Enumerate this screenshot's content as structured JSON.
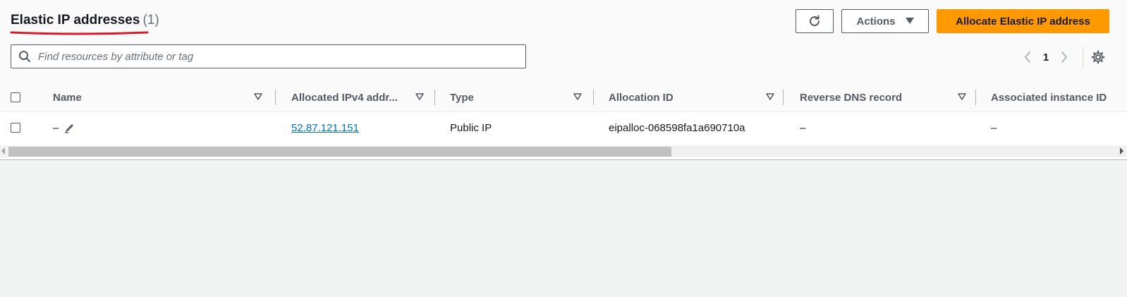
{
  "header": {
    "title": "Elastic IP addresses",
    "count": "(1)",
    "actions_label": "Actions",
    "allocate_label": "Allocate Elastic IP address"
  },
  "search": {
    "placeholder": "Find resources by attribute or tag",
    "value": ""
  },
  "pagination": {
    "current_page": "1"
  },
  "table": {
    "columns": [
      "Name",
      "Allocated IPv4 addr...",
      "Type",
      "Allocation ID",
      "Reverse DNS record",
      "Associated instance ID"
    ],
    "rows": [
      {
        "name": "–",
        "ipv4": "52.87.121.151",
        "type": "Public IP",
        "allocation_id": "eipalloc-068598fa1a690710a",
        "reverse_dns": "–",
        "associated_instance": "–"
      }
    ]
  },
  "colors": {
    "primary_button": "#ff9900",
    "link": "#0073bb",
    "annotation_underline": "#d81b2a"
  },
  "icons": [
    "refresh-icon",
    "caret-down-icon",
    "search-icon",
    "chevron-left-icon",
    "chevron-right-icon",
    "gear-icon",
    "sort-icon",
    "edit-pencil-icon"
  ]
}
